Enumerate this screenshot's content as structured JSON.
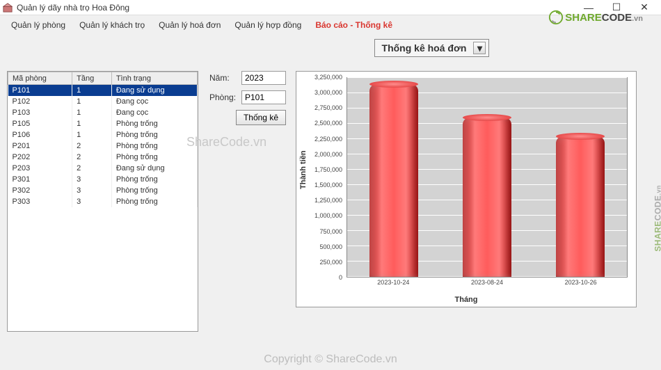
{
  "window": {
    "title": "Quản lý dãy nhà trọ Hoa Đông"
  },
  "menu": {
    "items": [
      "Quản lý phòng",
      "Quản lý khách trọ",
      "Quản lý hoá đơn",
      "Quản lý hợp đồng",
      "Báo cáo - Thống kê"
    ],
    "active_index": 4
  },
  "combo": {
    "label": "Thống kê hoá đơn"
  },
  "form": {
    "year_label": "Năm:",
    "year_value": "2023",
    "room_label": "Phòng:",
    "room_value": "P101",
    "button": "Thống kê"
  },
  "table": {
    "headers": [
      "Mã phòng",
      "Tầng",
      "Tình trạng"
    ],
    "rows": [
      {
        "ma": "P101",
        "tang": "1",
        "tinhtrang": "Đang sử dụng",
        "selected": true
      },
      {
        "ma": "P102",
        "tang": "1",
        "tinhtrang": "Đang cọc"
      },
      {
        "ma": "P103",
        "tang": "1",
        "tinhtrang": "Đang cọc"
      },
      {
        "ma": "P105",
        "tang": "1",
        "tinhtrang": "Phòng trống"
      },
      {
        "ma": "P106",
        "tang": "1",
        "tinhtrang": "Phòng trống"
      },
      {
        "ma": "P201",
        "tang": "2",
        "tinhtrang": "Phòng trống"
      },
      {
        "ma": "P202",
        "tang": "2",
        "tinhtrang": "Phòng trống"
      },
      {
        "ma": "P203",
        "tang": "2",
        "tinhtrang": "Đang sử dụng"
      },
      {
        "ma": "P301",
        "tang": "3",
        "tinhtrang": "Phòng trống"
      },
      {
        "ma": "P302",
        "tang": "3",
        "tinhtrang": "Phòng trống"
      },
      {
        "ma": "P303",
        "tang": "3",
        "tinhtrang": "Phòng trống"
      }
    ]
  },
  "chart_data": {
    "type": "bar",
    "categories": [
      "2023-10-24",
      "2023-08-24",
      "2023-10-26"
    ],
    "values": [
      3150000,
      2600000,
      2300000
    ],
    "title": "",
    "xlabel": "Tháng",
    "ylabel": "Thành tiền",
    "ylim": [
      0,
      3250000
    ],
    "y_ticks": [
      0,
      250000,
      500000,
      750000,
      1000000,
      1250000,
      1500000,
      1750000,
      2000000,
      2250000,
      2500000,
      2750000,
      3000000,
      3250000
    ],
    "y_tick_labels": [
      "0",
      "250,000",
      "500,000",
      "750,000",
      "1,000,000",
      "1,250,000",
      "1,500,000",
      "1,750,000",
      "2,000,000",
      "2,250,000",
      "2,500,000",
      "2,750,000",
      "3,000,000",
      "3,250,000"
    ]
  },
  "watermarks": {
    "brand_share": "SHARE",
    "brand_code": "CODE",
    "brand_vn": ".vn",
    "mid": "ShareCode.vn",
    "bottom": "Copyright © ShareCode.vn"
  }
}
